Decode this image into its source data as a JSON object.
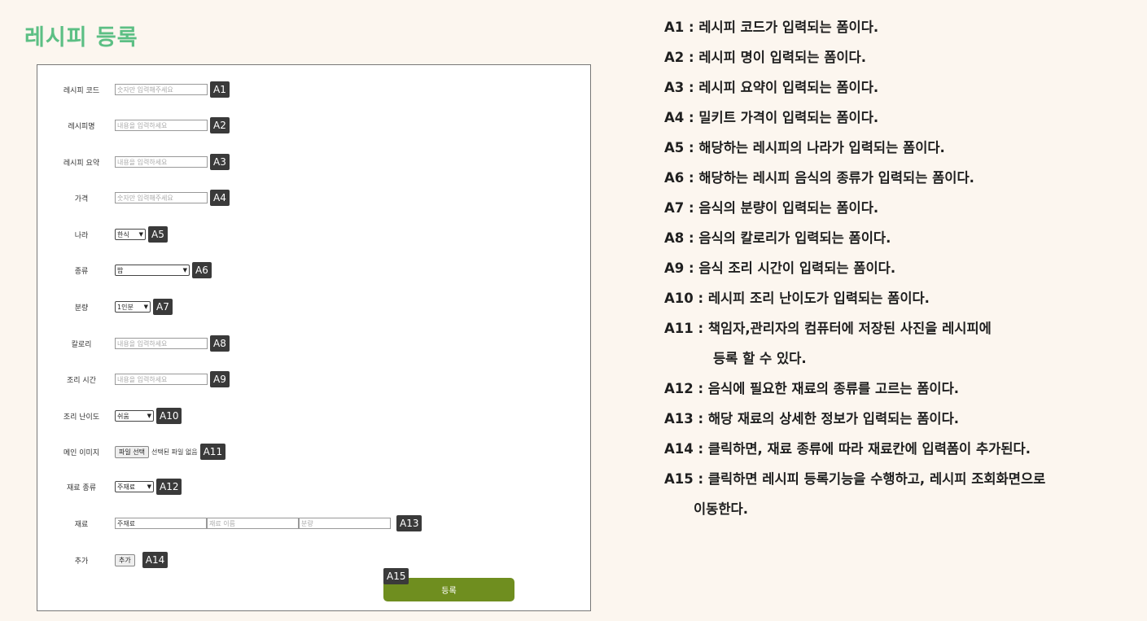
{
  "page_title": "레시피 등록",
  "form": {
    "fields": [
      {
        "label": "레시피 코드",
        "placeholder": "숫자만 입력해주세요",
        "tag": "A1"
      },
      {
        "label": "레시피명",
        "placeholder": "내용을 입력하세요",
        "tag": "A2"
      },
      {
        "label": "레시피 요약",
        "placeholder": "내용을 입력하세요",
        "tag": "A3"
      },
      {
        "label": "가격",
        "placeholder": "숫자만 입력해주세요",
        "tag": "A4"
      },
      {
        "label": "나라",
        "selected": "한식",
        "tag": "A5"
      },
      {
        "label": "종류",
        "selected": "밥",
        "tag": "A6"
      },
      {
        "label": "분량",
        "selected": "1인분",
        "tag": "A7"
      },
      {
        "label": "칼로리",
        "placeholder": "내용을 입력하세요",
        "tag": "A8"
      },
      {
        "label": "조리 시간",
        "placeholder": "내용을 입력하세요",
        "tag": "A9"
      },
      {
        "label": "조리 난이도",
        "selected": "쉬움",
        "tag": "A10"
      },
      {
        "label": "메인 이미지",
        "button": "파일 선택",
        "note": "선택된 파일 없음",
        "tag": "A11"
      },
      {
        "label": "재료 종류",
        "selected": "주재료",
        "tag": "A12"
      },
      {
        "label": "재료",
        "value": "주재료",
        "placeholder2": "재료 이름",
        "placeholder3": "분량",
        "tag": "A13"
      },
      {
        "label": "추가",
        "button": "추가",
        "tag": "A14"
      }
    ],
    "submit_label": "등록",
    "submit_tag": "A15",
    "submit_color": "#6f8e1f"
  },
  "descriptions": [
    "A1 : 레시피 코드가 입력되는 폼이다.",
    "A2 : 레시피 명이 입력되는 폼이다.",
    "A3 : 레시피 요약이 입력되는 폼이다.",
    "A4 : 밀키트 가격이 입력되는 폼이다.",
    "A5 : 해당하는 레시피의 나라가 입력되는 폼이다.",
    "A6 : 해당하는 레시피 음식의 종류가 입력되는 폼이다.",
    "A7 : 음식의 분량이 입력되는 폼이다.",
    "A8 : 음식의 칼로리가 입력되는 폼이다.",
    "A9 : 음식 조리 시간이 입력되는 폼이다.",
    "A10 : 레시피 조리 난이도가 입력되는 폼이다.",
    "A11 : 책임자,관리자의 컴퓨터에 저장된 사진을 레시피에",
    "등록 할 수 있다.",
    "A12 : 음식에 필요한 재료의 종류를 고르는 폼이다.",
    "A13 : 해당 재료의 상세한 정보가 입력되는 폼이다.",
    "A14 : 클릭하면, 재료 종류에 따라 재료칸에 입력폼이 추가된다.",
    "A15 : 클릭하면 레시피 등록기능을 수행하고, 레시피 조회화면으로",
    "이동한다."
  ],
  "colors": {
    "title": "#5cbf84",
    "background": "#fcf6ef",
    "tag": "#3a3a3a"
  }
}
